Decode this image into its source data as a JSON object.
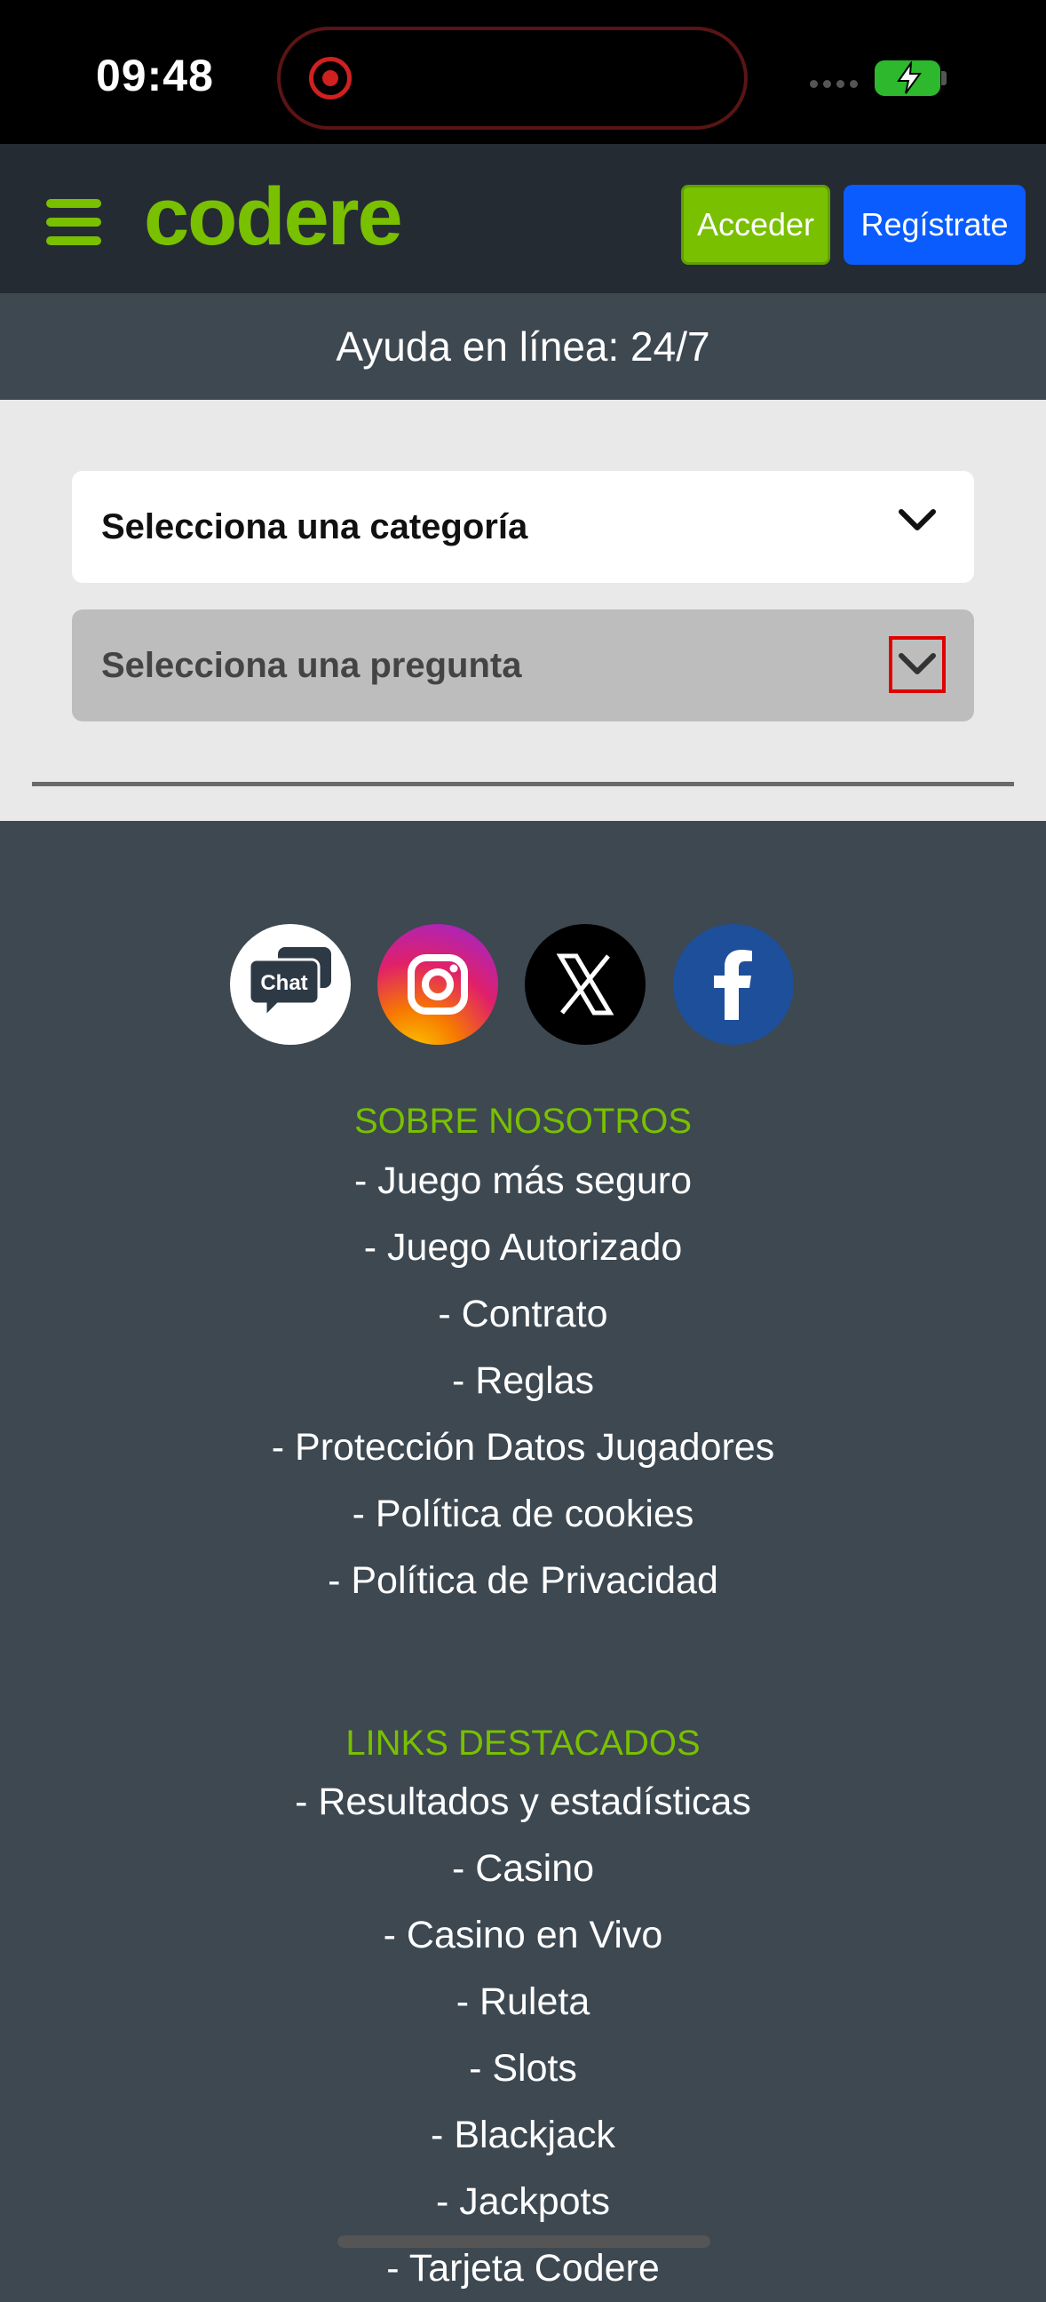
{
  "status_bar": {
    "time": "09:48",
    "icons": [
      "screen-record-icon",
      "signal-icon",
      "battery-charging-icon"
    ]
  },
  "header": {
    "logo_text": "codere",
    "login_label": "Acceder",
    "register_label": "Regístrate",
    "colors": {
      "brand_green": "#79c000",
      "register_blue": "#0a5cff",
      "header_bg": "#252b33"
    }
  },
  "help_bar": {
    "text": "Ayuda en línea: 24/7"
  },
  "selects": {
    "category": "Selecciona una categoría",
    "question": "Selecciona una pregunta"
  },
  "socials": {
    "chat_label": "Chat",
    "icons": [
      "chat-icon",
      "instagram-icon",
      "x-icon",
      "facebook-icon"
    ]
  },
  "footer": {
    "about_title": "SOBRE NOSOTROS",
    "about_links": [
      "- Juego más seguro",
      "- Juego Autorizado",
      "- Contrato",
      "- Reglas",
      "- Protección Datos Jugadores",
      "- Política de cookies",
      "- Política de Privacidad"
    ],
    "featured_title": "LINKS DESTACADOS",
    "featured_links": [
      "- Resultados y estadísticas",
      "- Casino",
      "- Casino en Vivo",
      "- Ruleta",
      "- Slots",
      "- Blackjack",
      "- Jackpots",
      "- Tarjeta Codere"
    ]
  }
}
